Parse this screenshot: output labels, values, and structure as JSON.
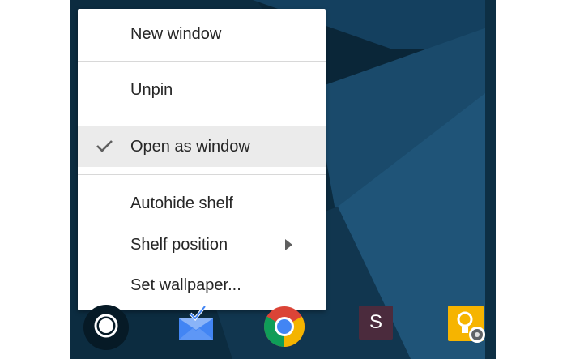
{
  "context_menu": {
    "items": [
      {
        "label": "New window"
      },
      {
        "label": "Unpin"
      },
      {
        "label": "Open as window",
        "checked": true,
        "highlighted": true
      },
      {
        "label": "Autohide shelf"
      },
      {
        "label": "Shelf position",
        "has_submenu": true
      },
      {
        "label": "Set wallpaper..."
      }
    ]
  },
  "shelf": {
    "apps": [
      {
        "name": "launcher",
        "icon": "launcher-circle-icon"
      },
      {
        "name": "inbox",
        "icon": "inbox-envelope-icon"
      },
      {
        "name": "chrome",
        "icon": "chrome-icon"
      },
      {
        "name": "slack",
        "icon": "s-app-icon",
        "letter": "S",
        "color": "#4b2b3d"
      },
      {
        "name": "keep",
        "icon": "keep-bulb-icon",
        "color": "#f6b400"
      }
    ]
  },
  "colors": {
    "wallpaper_dark": "#0b2a3d",
    "wallpaper_mid": "#123a55",
    "wallpaper_light": "#1d4d6e",
    "menu_highlight": "#ebebeb"
  }
}
